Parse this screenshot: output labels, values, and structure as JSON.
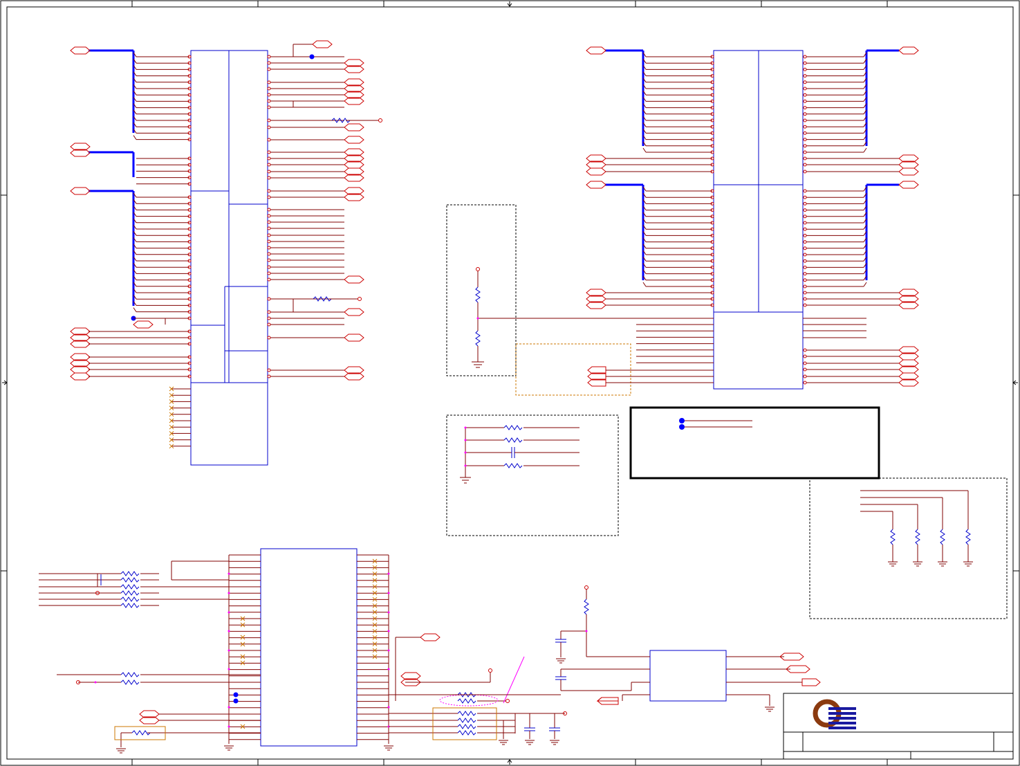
{
  "colors": {
    "frame": "#000000",
    "wire": "#800000",
    "port": "#cc0000",
    "body": "#0000cc",
    "bus": "#0000ff",
    "junction": "#ff00ff",
    "note": "#cc7700",
    "dashed": "#000000",
    "logo_ring": "#8b3a0f",
    "logo_bars": "#1a1aa0"
  }
}
